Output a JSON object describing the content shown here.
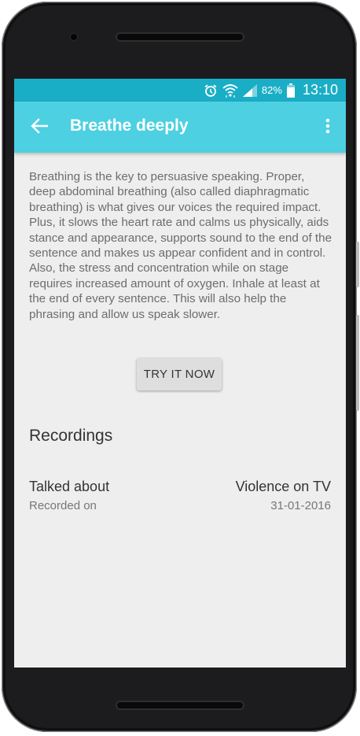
{
  "status_bar": {
    "battery_percent": "82%",
    "time": "13:10",
    "icons": [
      "alarm-icon",
      "wifi-icon",
      "signal-icon",
      "battery-icon"
    ]
  },
  "app_bar": {
    "title": "Breathe deeply",
    "back_icon": "arrow-back-icon",
    "menu_icon": "more-vert-icon"
  },
  "content": {
    "description": "Breathing is the key to persuasive speaking. Proper, deep abdominal breathing (also called diaphragmatic breathing) is what gives our voices the required impact. Plus, it slows the heart rate and calms us physically, aids stance and appearance, supports sound to the end of the sentence and makes us appear confident and in control. Also, the stress and concentration while on stage requires increased amount of oxygen. Inhale at least at the end of every sentence. This will also help the phrasing and allow us speak slower.",
    "try_button_label": "TRY IT NOW"
  },
  "recordings": {
    "heading": "Recordings",
    "items": [
      {
        "topic_label": "Talked about",
        "topic_value": "Violence on TV",
        "date_label": "Recorded on",
        "date_value": "31-01-2016"
      }
    ]
  },
  "colors": {
    "status_bar": "#1aaec6",
    "app_bar": "#4dd0e1",
    "background": "#eeeeee",
    "button": "#dedede"
  }
}
